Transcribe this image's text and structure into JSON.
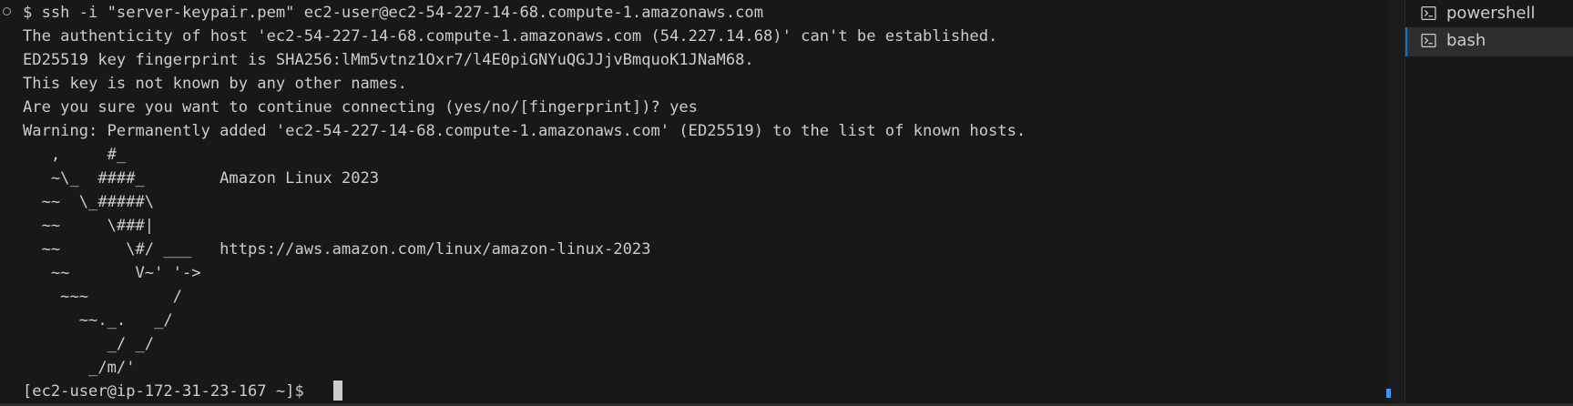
{
  "terminal": {
    "lines": [
      "$ ssh -i \"server-keypair.pem\" ec2-user@ec2-54-227-14-68.compute-1.amazonaws.com",
      "The authenticity of host 'ec2-54-227-14-68.compute-1.amazonaws.com (54.227.14.68)' can't be established.",
      "ED25519 key fingerprint is SHA256:lMm5vtnz1Oxr7/l4E0piGNYuQGJJjvBmquoK1JNaM68.",
      "This key is not known by any other names.",
      "Are you sure you want to continue connecting (yes/no/[fingerprint])? yes",
      "Warning: Permanently added 'ec2-54-227-14-68.compute-1.amazonaws.com' (ED25519) to the list of known hosts.",
      "   ,     #_",
      "   ~\\_  ####_        Amazon Linux 2023",
      "  ~~  \\_#####\\",
      "  ~~     \\###|",
      "  ~~       \\#/ ___   https://aws.amazon.com/linux/amazon-linux-2023",
      "   ~~       V~' '->",
      "    ~~~         /",
      "      ~~._.   _/",
      "         _/ _/",
      "       _/m/'",
      "[ec2-user@ip-172-31-23-167 ~]$ "
    ]
  },
  "tabs": [
    {
      "label": "powershell",
      "icon": "terminal-icon",
      "active": false
    },
    {
      "label": "bash",
      "icon": "terminal-icon",
      "active": true
    }
  ],
  "colors": {
    "background": "#181818",
    "text": "#cccccc",
    "active_tab": "#2d2d2d",
    "accent": "#0078d4"
  }
}
